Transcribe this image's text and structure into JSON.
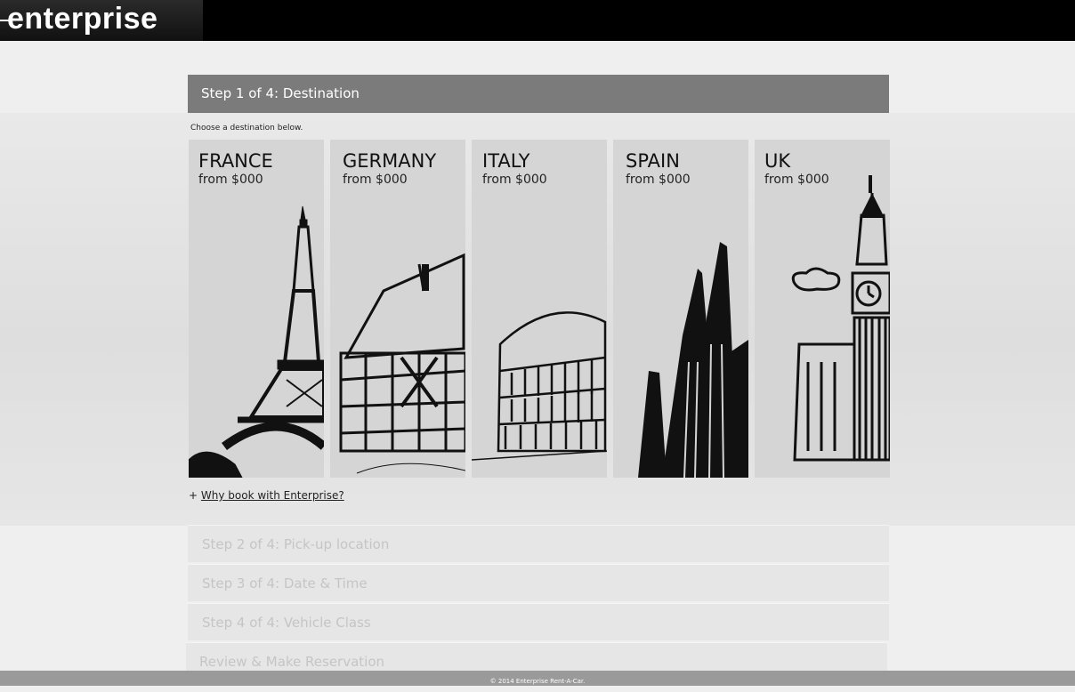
{
  "brand": {
    "logo_text": "enterprise"
  },
  "step1": {
    "header": "Step 1 of 4: Destination",
    "instructions": "Choose a destination below."
  },
  "destinations": [
    {
      "country": "FRANCE",
      "price": "from $000",
      "icon": "eiffel-tower-icon"
    },
    {
      "country": "GERMANY",
      "price": "from $000",
      "icon": "half-timbered-house-icon"
    },
    {
      "country": "ITALY",
      "price": "from $000",
      "icon": "colosseum-icon"
    },
    {
      "country": "SPAIN",
      "price": "from $000",
      "icon": "sagrada-familia-icon"
    },
    {
      "country": "UK",
      "price": "from $000",
      "icon": "big-ben-icon"
    }
  ],
  "why_book": {
    "prefix": "+",
    "label": "Why book with Enterprise?"
  },
  "steps": [
    "Step 2 of 4: Pick-up location",
    "Step 3 of 4: Date & Time",
    "Step 4 of 4: Vehicle Class",
    "Review & Make Reservation"
  ],
  "footer": {
    "copyright": "© 2014 Enterprise Rent-A-Car."
  },
  "colors": {
    "header_bg": "#7b7b7b",
    "card_bg": "#d5d5d5",
    "topbar": "#000000"
  }
}
